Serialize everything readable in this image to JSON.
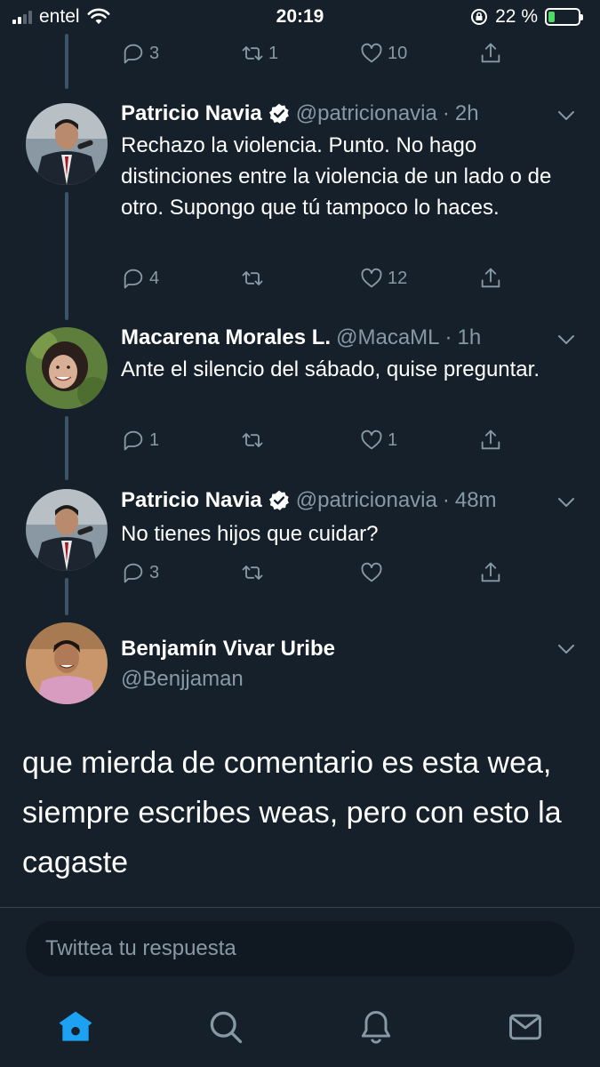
{
  "status_bar": {
    "carrier": "entel",
    "time": "20:19",
    "battery": "22 %",
    "battery_level": 0.22,
    "icons": [
      "signal-icon",
      "wifi-icon",
      "rotation-lock-icon",
      "battery-charging-icon"
    ]
  },
  "top_actions": {
    "reply_count": "3",
    "retweet_count": "1",
    "like_count": "10"
  },
  "tweets": [
    {
      "name": "Patricio Navia",
      "handle": "@patricionavia",
      "time": "2h",
      "verified": true,
      "text": "Rechazo la violencia. Punto. No hago distinciones entre la violencia de un lado o de otro. Supongo que tú tampoco lo haces.",
      "reply_count": "4",
      "retweet_count": "",
      "like_count": "12"
    },
    {
      "name": "Macarena Morales L.",
      "handle": "@MacaML",
      "time": "1h",
      "verified": false,
      "text": "Ante el silencio del sábado, quise preguntar.",
      "reply_count": "1",
      "retweet_count": "",
      "like_count": "1"
    },
    {
      "name": "Patricio Navia",
      "handle": "@patricionavia",
      "time": "48m",
      "verified": true,
      "text": "No tienes hijos que cuidar?",
      "reply_count": "3",
      "retweet_count": "",
      "like_count": ""
    }
  ],
  "main_tweet": {
    "name": "Benjamín Vivar Uribe",
    "handle": "@Benjjaman",
    "text": "que mierda de comentario es esta wea, siempre escribes weas, pero con esto la cagaste"
  },
  "reply_box": {
    "placeholder": "Twittea tu respuesta"
  },
  "tab_bar": [
    "home-icon",
    "search-icon",
    "notifications-icon",
    "messages-icon"
  ],
  "colors": {
    "background": "#15202b",
    "accent": "#1da1f2",
    "muted": "#8899a6",
    "thread_line": "#3d5466"
  }
}
